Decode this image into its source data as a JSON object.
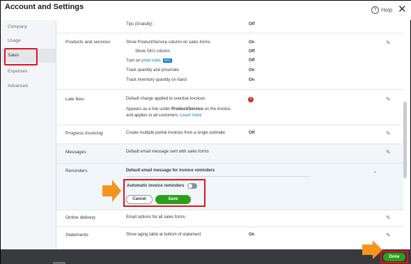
{
  "window": {
    "title": "Account and Settings",
    "help_label": "Help"
  },
  "sidebar": {
    "items": [
      {
        "label": "Company"
      },
      {
        "label": "Usage"
      },
      {
        "label": "Sales"
      },
      {
        "label": "Expenses"
      },
      {
        "label": "Advanced"
      }
    ],
    "active": "Sales"
  },
  "tips": {
    "label": "Tips (Gratuity)",
    "value": "Off"
  },
  "products": {
    "section": "Products and services",
    "items": [
      {
        "label": "Show Product/Service column on sales forms",
        "value": "On"
      },
      {
        "label": "Show SKU column",
        "value": "Off"
      },
      {
        "label_prefix": "Turn on ",
        "link": "price rules",
        "badge": "BETA",
        "value": "Off"
      },
      {
        "label": "Track quantity and price/rate",
        "value": "On"
      },
      {
        "label": "Track inventory quantity on hand",
        "value": "On"
      }
    ]
  },
  "late_fees": {
    "section": "Late fees",
    "line1": "Default charge applied to overdue invoices",
    "line2_prefix": "Appears as a line under ",
    "line2_bold": "Product/Service",
    "line2_suffix": " on the invoice,",
    "line3": "and applies to all customers. ",
    "learn_more": "Learn more"
  },
  "progress": {
    "section": "Progress Invoicing",
    "label": "Create multiple partial invoices from a single estimate",
    "value": "Off"
  },
  "messages": {
    "section": "Messages",
    "label": "Default email message sent with sales forms"
  },
  "reminders": {
    "section": "Reminders",
    "dropdown": "Default email message for invoice reminders",
    "toggle_label": "Automatic invoice reminders",
    "toggle_state": "off",
    "cancel": "Cancel",
    "save": "Save"
  },
  "online_delivery": {
    "section": "Online delivery",
    "label": "Email options for all sales forms"
  },
  "statements": {
    "section": "Statements",
    "label": "Show aging table at bottom of statement",
    "value": "On"
  },
  "footer": {
    "done": "Done"
  },
  "colors": {
    "accent_green": "#2ca01c",
    "highlight_red": "#e0131b",
    "arrow_orange": "#f7941d",
    "link_blue": "#0077c5"
  }
}
